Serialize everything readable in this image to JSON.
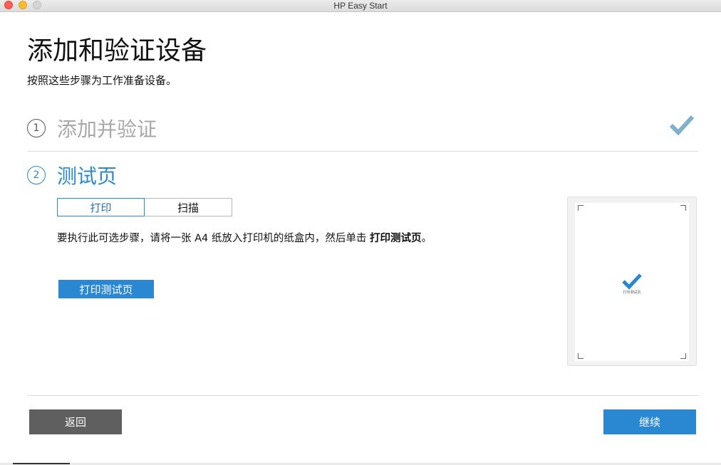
{
  "window": {
    "title": "HP Easy Start"
  },
  "header": {
    "title": "添加和验证设备",
    "subtitle": "按照这些步骤为工作准备设备。"
  },
  "steps": [
    {
      "number": "1",
      "label": "添加并验证",
      "status": "complete"
    },
    {
      "number": "2",
      "label": "测试页",
      "status": "active"
    }
  ],
  "test_page": {
    "tabs": [
      {
        "label": "打印",
        "selected": true
      },
      {
        "label": "扫描",
        "selected": false
      }
    ],
    "instruction_prefix": "要执行此可选步骤，请将一张 A4 纸放入打印机的纸盒内，然后单击 ",
    "instruction_emphasis": "打印测试页",
    "instruction_suffix": "。",
    "print_button_label": "打印测试页",
    "preview_caption": "打印测试页"
  },
  "footer": {
    "back_label": "返回",
    "continue_label": "继续"
  },
  "colors": {
    "accent": "#2a88d2",
    "check_done": "#7fb0cc",
    "back_button": "#5f5f5f"
  }
}
